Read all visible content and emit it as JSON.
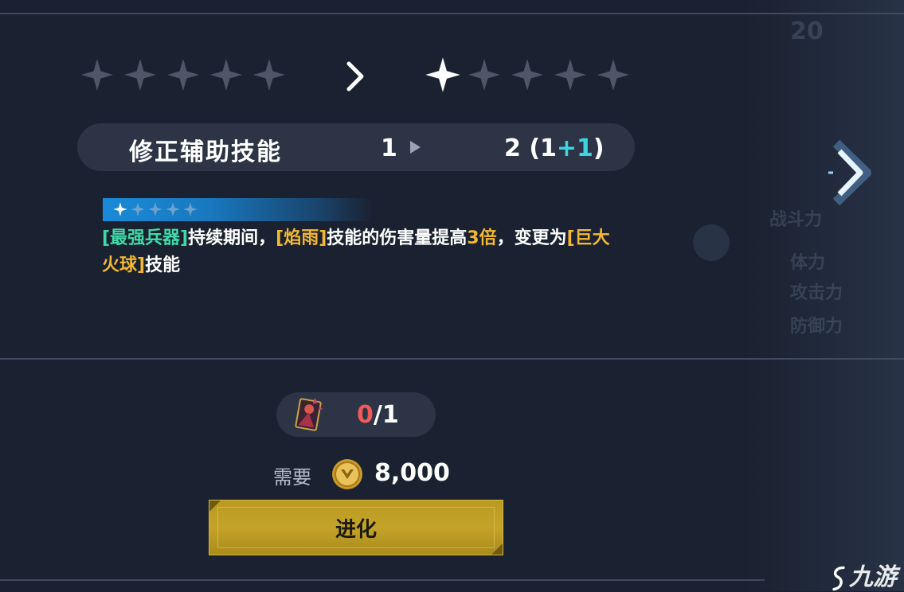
{
  "stars": {
    "current_filled": 0,
    "current_total": 5,
    "next_filled": 1,
    "next_total": 5
  },
  "skill": {
    "name": "修正辅助技能",
    "from": "1",
    "to_base": "2 (1",
    "to_plus": "+1",
    "to_close": ")"
  },
  "tier": {
    "filled": 1,
    "total": 5
  },
  "description": {
    "p1": "[最强兵器]",
    "p2": "持续期间，",
    "p3": "[焰雨]",
    "p4": "技能的伤害量提高",
    "p5": "3倍",
    "p6": "，变更为",
    "p7": "[巨大火球]",
    "p8": "技能"
  },
  "material": {
    "have": "0",
    "need": "/1"
  },
  "cost": {
    "label": "需要",
    "value": "8,000"
  },
  "evolve_button": "进化",
  "background_ghost": {
    "stat1": "战斗力",
    "stat2": "体力",
    "stat3": "攻击力",
    "stat4": "防御力"
  },
  "watermark": "九游",
  "colors": {
    "background": "#1a2130",
    "panel": "#2c3446",
    "green_highlight": "#3fd9a8",
    "gold_highlight": "#f3b830",
    "deficit_red": "#f15a5a",
    "plus_cyan": "#39d7e0",
    "button_gold": "#c5a329"
  }
}
